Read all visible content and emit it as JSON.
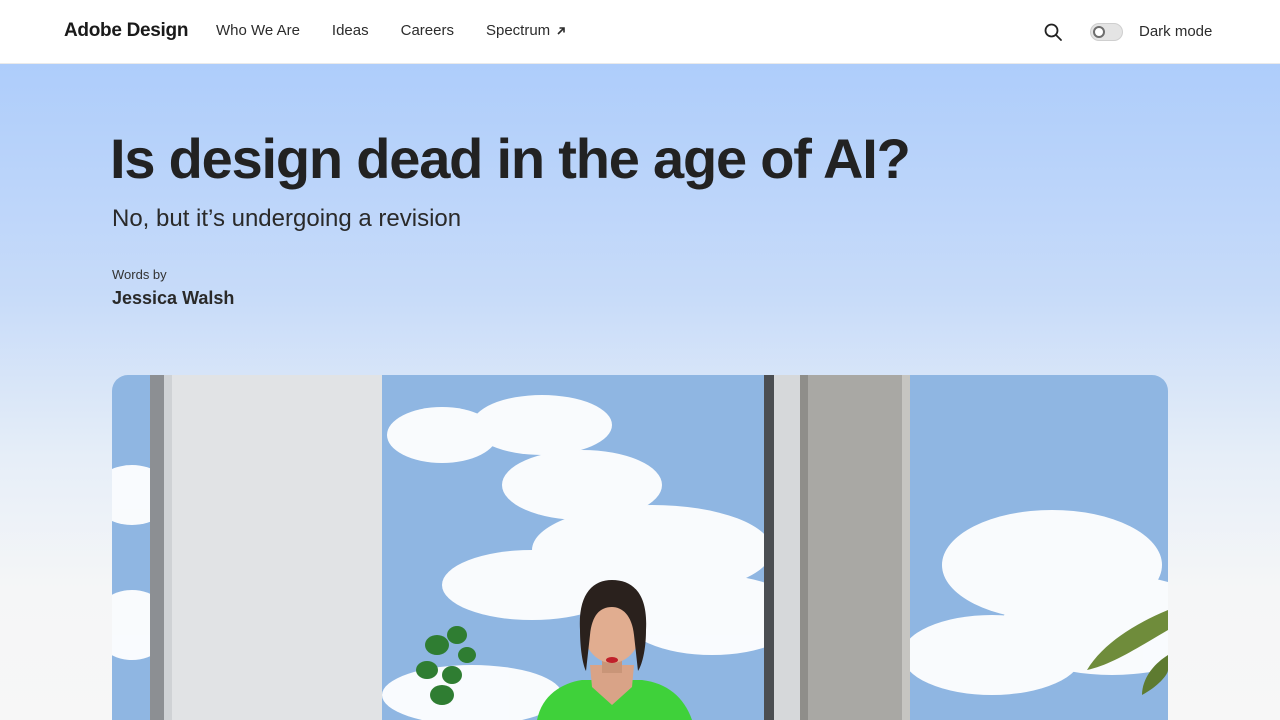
{
  "header": {
    "brand": "Adobe Design",
    "nav": [
      {
        "label": "Who We Are"
      },
      {
        "label": "Ideas"
      },
      {
        "label": "Careers"
      },
      {
        "label": "Spectrum"
      }
    ],
    "dark_mode_label": "Dark mode",
    "icons": [
      "search-icon",
      "external-link-icon",
      "toggle-switch"
    ]
  },
  "article": {
    "title": "Is design dead in the age of AI?",
    "subtitle": "No, but it’s undergoing a revision",
    "byline_label": "Words by",
    "author": "Jessica Walsh"
  },
  "colors": {
    "hero_top": "#aecdfb",
    "hero_bottom": "#f7f7f7",
    "text": "#222222",
    "dress_green": "#3fd13a"
  }
}
